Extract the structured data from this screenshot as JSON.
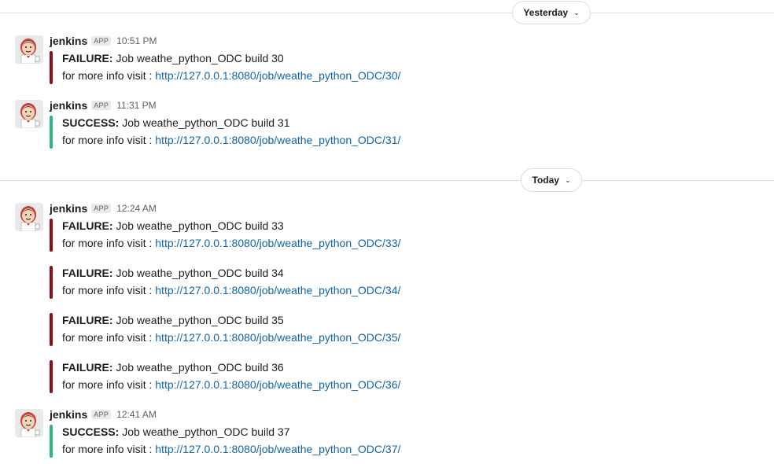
{
  "days": {
    "yesterday": "Yesterday",
    "today": "Today",
    "chevron_icon": "chevron-down-icon"
  },
  "colors": {
    "failure": "#8b0e16",
    "success": "#2eb67d",
    "link": "#1264a3"
  },
  "groups": [
    {
      "sender": "jenkins",
      "badge": "APP",
      "time": "10:51 PM",
      "attachments": [
        {
          "status": "FAILURE:",
          "text": " Job weathe_python_ODC build 30",
          "info": "for more info visit : ",
          "url": "http://127.0.0.1:8080/job/weathe_python_ODC/30/"
        }
      ]
    },
    {
      "sender": "jenkins",
      "badge": "APP",
      "time": "11:31 PM",
      "attachments": [
        {
          "status": "SUCCESS:",
          "text": " Job weathe_python_ODC build 31",
          "info": "for more info visit : ",
          "url": "http://127.0.0.1:8080/job/weathe_python_ODC/31/"
        }
      ]
    },
    {
      "sender": "jenkins",
      "badge": "APP",
      "time": "12:24 AM",
      "attachments": [
        {
          "status": "FAILURE:",
          "text": " Job weathe_python_ODC build 33",
          "info": "for more info visit : ",
          "url": "http://127.0.0.1:8080/job/weathe_python_ODC/33/"
        },
        {
          "status": "FAILURE:",
          "text": " Job weathe_python_ODC build 34",
          "info": "for more info visit : ",
          "url": "http://127.0.0.1:8080/job/weathe_python_ODC/34/"
        },
        {
          "status": "FAILURE:",
          "text": " Job weathe_python_ODC build 35",
          "info": "for more info visit : ",
          "url": "http://127.0.0.1:8080/job/weathe_python_ODC/35/"
        },
        {
          "status": "FAILURE:",
          "text": " Job weathe_python_ODC build 36",
          "info": "for more info visit : ",
          "url": "http://127.0.0.1:8080/job/weathe_python_ODC/36/"
        }
      ]
    },
    {
      "sender": "jenkins",
      "badge": "APP",
      "time": "12:41 AM",
      "attachments": [
        {
          "status": "SUCCESS:",
          "text": " Job weathe_python_ODC build 37",
          "info": "for more info visit : ",
          "url": "http://127.0.0.1:8080/job/weathe_python_ODC/37/"
        }
      ]
    }
  ]
}
